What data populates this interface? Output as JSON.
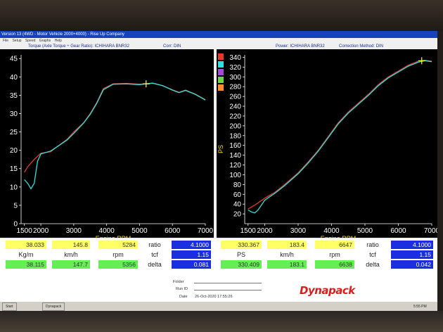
{
  "window": {
    "title": "Version 13 (4WD - Motor Vehicle 2000+4000) - Rise Up Company"
  },
  "menu": [
    "File",
    "Setup",
    "Speed",
    "Graphs",
    "Help"
  ],
  "left_header": {
    "graph": "Torque (Axle Torque ÷ Gear Ratio): ICHIHARA BNR32",
    "corr": "Corr: DIN"
  },
  "right_header": {
    "power": "Power: ICHIHARA BNR32",
    "method": "Correction Method: DIN"
  },
  "colors": {
    "run_red": "#e23b2a",
    "run_cyan": "#2ee0e0",
    "plot_bg": "#000000",
    "axis_label": "#ffdd00"
  },
  "chart_data": [
    {
      "type": "line",
      "title": "Torque (Axle Torque ÷ Gear Ratio): ICHIHARA BNR32",
      "xlabel": "Engine RPM",
      "ylabel": "",
      "xlim": [
        1400,
        7000
      ],
      "ylim": [
        0,
        46
      ],
      "x_ticks": [
        "1500",
        "2000",
        "3000",
        "4000",
        "5000",
        "6000",
        "7000"
      ],
      "y_ticks": [
        "0",
        "5",
        "10",
        "15",
        "20",
        "25",
        "30",
        "35",
        "40",
        "45"
      ],
      "series": [
        {
          "color": "#e23b2a",
          "x": [
            1500,
            1600,
            1800,
            2000,
            2300,
            2500,
            2800,
            3000,
            3300,
            3500,
            3700,
            3900,
            4200,
            4600,
            5000,
            5200,
            5400,
            5700,
            6000,
            6200,
            6400,
            6700,
            7000
          ],
          "y": [
            14,
            15.5,
            17.5,
            19.2,
            19.6,
            21,
            23,
            25,
            27.5,
            30,
            33,
            36.8,
            38.1,
            38.2,
            38.0,
            38.1,
            38.3,
            37.6,
            36.5,
            35.8,
            36.4,
            35.3,
            33.8
          ]
        },
        {
          "color": "#2ee0e0",
          "x": [
            1500,
            1600,
            1700,
            1800,
            1900,
            2000,
            2300,
            2500,
            2800,
            3000,
            3300,
            3500,
            3700,
            3900,
            4200,
            4600,
            5000,
            5200,
            5400,
            5700,
            6000,
            6200,
            6400,
            6700,
            7000
          ],
          "y": [
            12,
            11,
            9.5,
            11,
            17,
            19,
            19.8,
            21,
            22.8,
            24.6,
            27.4,
            29.8,
            32.8,
            36.5,
            38.0,
            38.1,
            37.9,
            38.1,
            38.3,
            37.6,
            36.4,
            35.7,
            36.3,
            35.2,
            33.7
          ]
        }
      ]
    },
    {
      "type": "line",
      "title": "Power: ICHIHARA BNR32",
      "xlabel": "Engine RPM",
      "ylabel": "PS",
      "xlim": [
        1400,
        7000
      ],
      "ylim": [
        0,
        345
      ],
      "x_ticks": [
        "1500",
        "2000",
        "3000",
        "4000",
        "5000",
        "6000",
        "7000"
      ],
      "y_ticks": [
        "20",
        "40",
        "60",
        "80",
        "100",
        "120",
        "140",
        "160",
        "180",
        "200",
        "220",
        "240",
        "260",
        "280",
        "300",
        "320",
        "340"
      ],
      "series": [
        {
          "color": "#e23b2a",
          "x": [
            1500,
            1700,
            2000,
            2300,
            2600,
            3000,
            3300,
            3600,
            3900,
            4200,
            4500,
            4800,
            5100,
            5400,
            5700,
            6000,
            6300,
            6600,
            6800,
            7000
          ],
          "y": [
            30,
            38,
            52,
            64,
            80,
            104,
            126,
            150,
            178,
            206,
            228,
            246,
            264,
            284,
            300,
            312,
            324,
            332,
            334,
            332
          ]
        },
        {
          "color": "#2ee0e0",
          "x": [
            1500,
            1600,
            1700,
            1800,
            2000,
            2300,
            2600,
            3000,
            3300,
            3600,
            3900,
            4200,
            4500,
            4800,
            5100,
            5400,
            5700,
            6000,
            6300,
            6600,
            6800,
            7000
          ],
          "y": [
            28,
            24,
            22,
            28,
            48,
            62,
            78,
            102,
            124,
            148,
            176,
            204,
            226,
            244,
            262,
            282,
            298,
            310,
            322,
            330,
            333,
            331
          ]
        }
      ]
    }
  ],
  "values": {
    "left": {
      "row1": {
        "kgm": "38.033",
        "kmh": "145.8",
        "rpm": "5284"
      },
      "units": {
        "kgm": "Kg/m",
        "kmh": "km/h",
        "rpm": "rpm"
      },
      "row2": {
        "kgm": "38.115",
        "kmh": "147.7",
        "rpm": "5356"
      },
      "ratio_label": "ratio",
      "ratio": "4.1000",
      "tcf_label": "tcf",
      "tcf": "1.15",
      "delta_label": "delta",
      "delta": "0.081"
    },
    "right": {
      "row1": {
        "ps": "330.367",
        "kmh": "183.4",
        "rpm": "6647"
      },
      "units": {
        "ps": "PS",
        "kmh": "km/h",
        "rpm": "rpm"
      },
      "row2": {
        "ps": "330.409",
        "kmh": "183.1",
        "rpm": "6638"
      },
      "ratio_label": "ratio",
      "ratio": "4.1000",
      "tcf_label": "tcf",
      "tcf": "1.15",
      "delta_label": "delta",
      "delta": "0.042"
    }
  },
  "footer": {
    "folder": "Folder",
    "runid": "Run ID",
    "date_label": "Date",
    "date": "26-Oct-2020 17:55:26",
    "brand": "Dynapack"
  },
  "taskbar": {
    "start": "Start",
    "app": "Dynapack",
    "time": "5:55 PM"
  }
}
